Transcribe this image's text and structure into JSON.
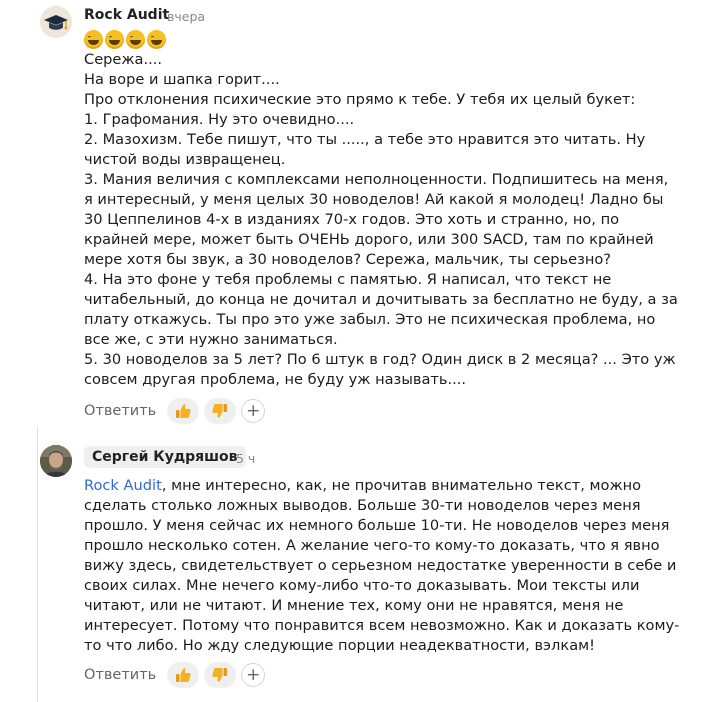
{
  "comments": [
    {
      "author": "Rock Audit",
      "time": "вчера",
      "emojis": [
        "laughing-face-icon",
        "laughing-face-icon",
        "laughing-face-icon",
        "laughing-face-icon"
      ],
      "lines": [
        "Сережа....",
        "На воре и шапка горит....",
        "Про отклонения психические это прямо к тебе. У тебя их целый букет:",
        "1. Графомания. Ну это очевидно....",
        "2. Мазохизм. Тебе пишут, что ты ....., а тебе это нравится это читать. Ну",
        "чистой воды извращенец.",
        "3. Мания величия с комплексами неполноценности. Подпишитесь на меня,",
        "я интересный, у меня целых 30 новоделов! Ай какой я молодец! Ладно бы",
        "30 Цеппелинов 4-х в изданиях 70-х годов. Это хоть и странно, но, по",
        "крайней мере, может быть ОЧЕНЬ дорого, или 300 SACD, там по крайней",
        "мере хотя бы звук, а 30 новоделов? Сережа, мальчик, ты серьезно?",
        "4. На это фоне у тебя проблемы с памятью. Я написал, что текст не",
        "читабельный, до конца не дочитал и дочитывать за бесплатно не буду, а за",
        "плату откажусь. Ты про это уже забыл. Это не психическая проблема, но",
        "все же, с эти нужно заниматься.",
        "5. 30 новоделов за 5 лет? По 6 штук в год? Один диск в 2 месяца? ... Это уж",
        "совсем другая проблема, не буду уж называть...."
      ],
      "reply_label": "Ответить"
    },
    {
      "author": "Сергей Кудряшов",
      "time": "5 ч",
      "mention": "Rock Audit",
      "first_line_rest": ", мне интересно, как, не прочитав внимательно текст, можно",
      "lines": [
        "сделать столько ложных выводов. Больше 30-ти новоделов через меня",
        "прошло. У меня сейчас их немного больше 10-ти. Не новоделов через меня",
        "прошло несколько сотен. А желание чего-то кому-то доказать, что я явно",
        "вижу здесь, свидетельствует о серьезном недостатке уверенности в себе и",
        "своих силах. Мне нечего кому-либо что-то доказывать. Мои тексты или",
        "читают, или не читают. И мнение тех, кому они не нравятся, меня не",
        "интересует. Потому что понравится всем невозможно. Как и доказать кому-",
        "то что либо. Но жду следующие порции неадекватности, вэлкам!"
      ],
      "reply_label": "Ответить"
    }
  ],
  "icons": {
    "like": "thumbs-up-icon",
    "dislike": "thumbs-down-icon",
    "add_reaction": "+"
  }
}
